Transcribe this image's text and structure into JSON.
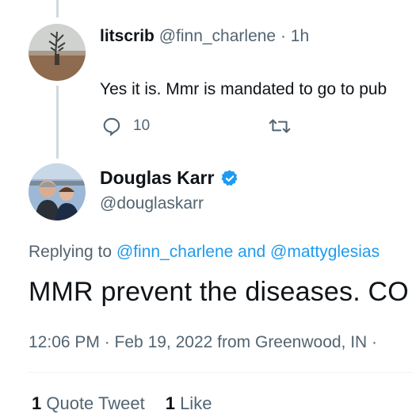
{
  "reply": {
    "name": "litscrib",
    "handle": "@finn_charlene",
    "separator": " · ",
    "time": "1h",
    "text_line1": "Yes it is. Mmr is mandated to go to pub",
    "text_line2": "mandated",
    "reply_count": "10",
    "icons": {
      "reply": "comment-icon",
      "retweet": "retweet-icon"
    }
  },
  "author": {
    "name": "Douglas Karr",
    "handle": "@douglaskarr",
    "verified_icon": "verified-badge-icon"
  },
  "tweet": {
    "replying_prefix": "Replying to ",
    "mention1": "@finn_charlene",
    "and_text": " and ",
    "mention2": "@mattyglesias",
    "text": "MMR prevent the diseases. CO",
    "timestamp": "12:06 PM · Feb 19, 2022 from Greenwood, IN ·"
  },
  "stats": {
    "quote_count": "1",
    "quote_label": " Quote Tweet",
    "like_count": "1",
    "like_label": " Like"
  },
  "colors": {
    "accent": "#1d9bf0",
    "secondary_text": "#536471",
    "primary_text": "#0f1419",
    "thread_line": "#cfd9de"
  }
}
